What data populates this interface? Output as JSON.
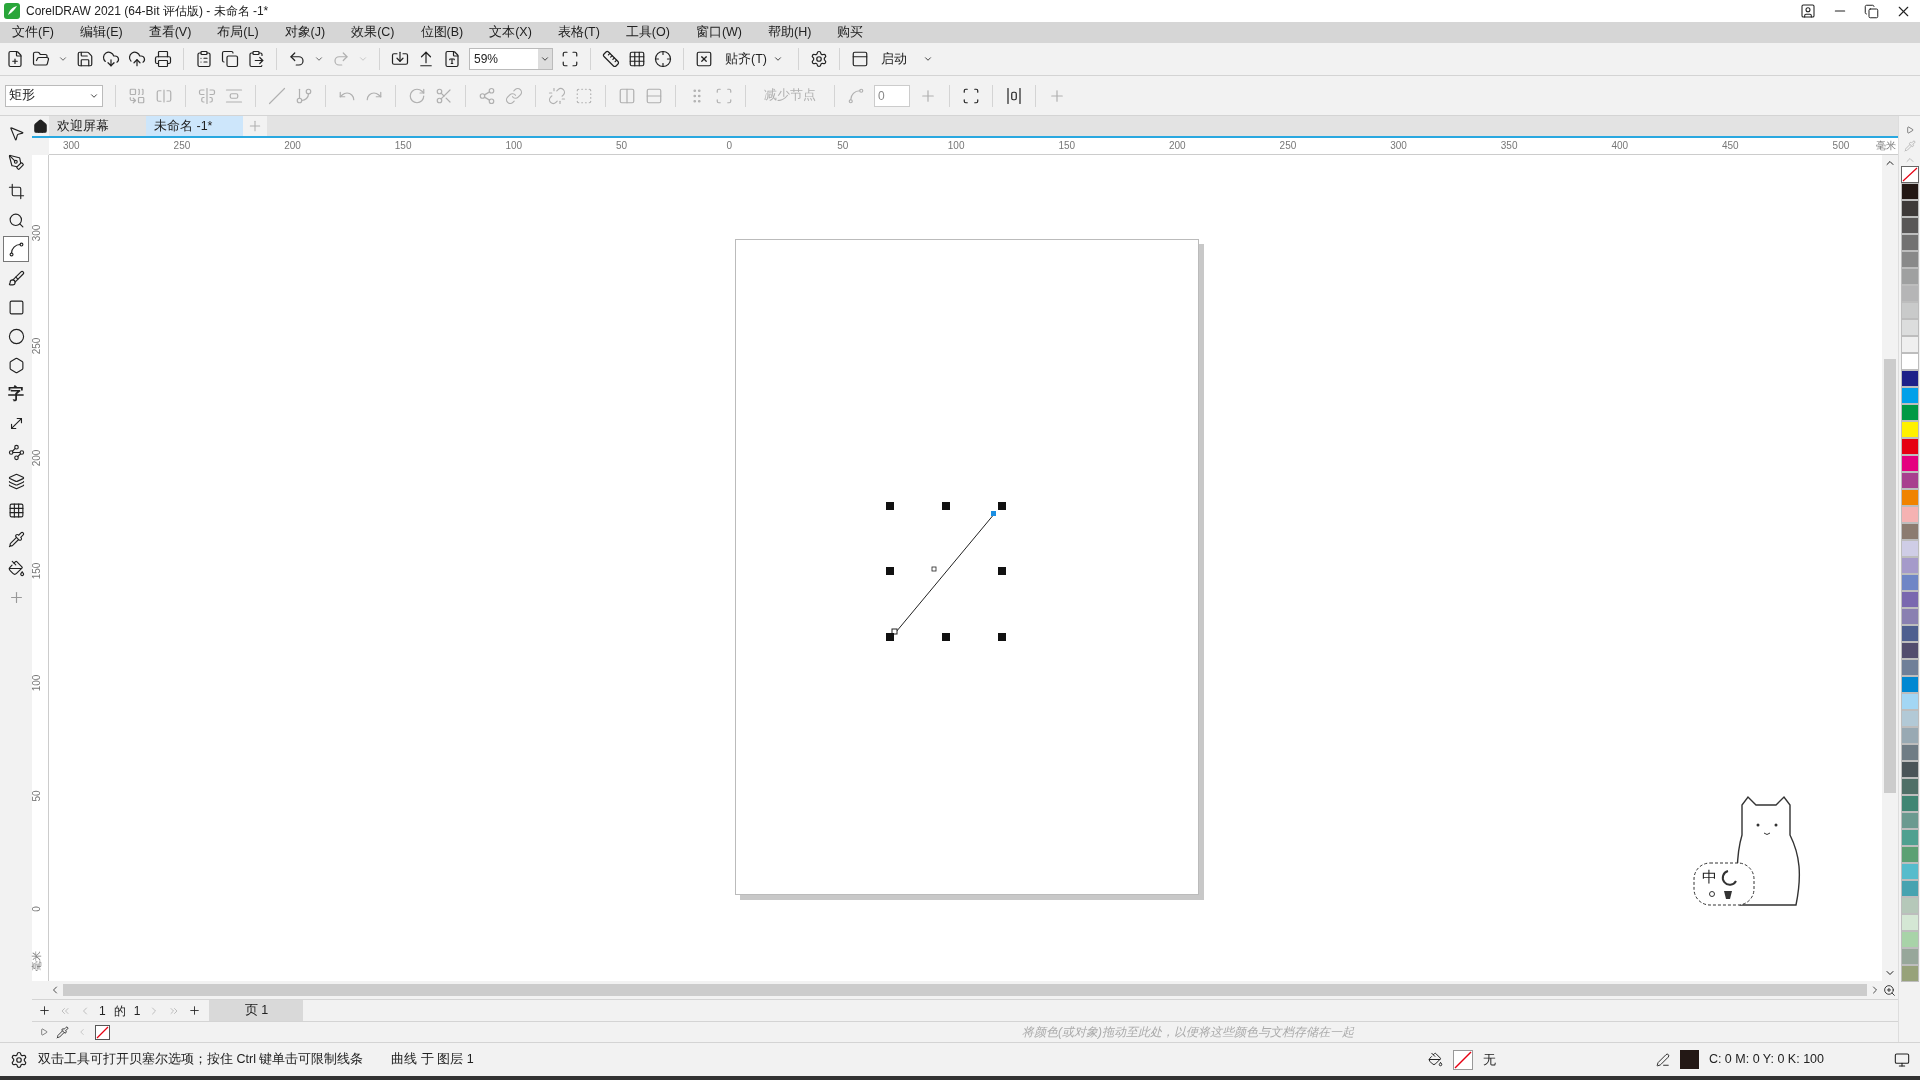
{
  "window": {
    "title": "CorelDRAW 2021 (64-Bit 评估版) - 未命名 -1*"
  },
  "menu": [
    "文件(F)",
    "编辑(E)",
    "查看(V)",
    "布局(L)",
    "对象(J)",
    "效果(C)",
    "位图(B)",
    "文本(X)",
    "表格(T)",
    "工具(O)",
    "窗口(W)",
    "帮助(H)",
    "购买"
  ],
  "toolbar": {
    "zoom": "59%",
    "snap": "贴齐(T)",
    "launch": "启动"
  },
  "property_bar": {
    "shape_type": "矩形",
    "reduce_nodes": {
      "label": "减少节点",
      "disabled": true
    },
    "smoothness": "0"
  },
  "tabs": [
    {
      "label": "欢迎屏幕",
      "selected": false
    },
    {
      "label": "未命名 -1*",
      "selected": true
    }
  ],
  "toolbox": [
    {
      "kind": "pointer",
      "selected": false
    },
    {
      "kind": "shape",
      "selected": false
    },
    {
      "kind": "crop",
      "selected": false
    },
    {
      "kind": "zoom",
      "selected": false
    },
    {
      "kind": "bezier",
      "selected": true
    },
    {
      "kind": "artistic",
      "selected": false
    },
    {
      "kind": "rectangle",
      "selected": false
    },
    {
      "kind": "ellipse",
      "selected": false
    },
    {
      "kind": "polygon",
      "selected": false
    },
    {
      "kind": "text",
      "glyph": "字",
      "selected": false
    },
    {
      "kind": "dimension",
      "selected": false
    },
    {
      "kind": "connector",
      "selected": false
    },
    {
      "kind": "shadow",
      "selected": false
    },
    {
      "kind": "transparency",
      "selected": false
    },
    {
      "kind": "eyedropper",
      "selected": false
    },
    {
      "kind": "fill",
      "selected": false
    },
    {
      "kind": "add",
      "selected": false
    }
  ],
  "rulers": {
    "horizontal": [
      "300",
      "250",
      "200",
      "150",
      "100",
      "50",
      "0",
      "50",
      "100",
      "150",
      "200",
      "250",
      "300",
      "350",
      "400",
      "450",
      "500"
    ],
    "unit": "毫米",
    "vertical": [
      "300",
      "250",
      "200",
      "150",
      "100",
      "50",
      "0"
    ],
    "vertical_unit": "毫米"
  },
  "ime": {
    "label": "中"
  },
  "page_nav": {
    "current": "1",
    "of": "的",
    "total": "1",
    "page_tab": "页 1"
  },
  "document_palette": {
    "hint": "将颜色(或对象)拖动至此处，以便将这些颜色与文档存储在一起"
  },
  "color_palette": [
    {
      "color": "#231815"
    },
    {
      "color": "#3e3a39"
    },
    {
      "color": "#595757"
    },
    {
      "color": "#727171"
    },
    {
      "color": "#898989"
    },
    {
      "color": "#9fa0a0"
    },
    {
      "color": "#b5b5b6"
    },
    {
      "color": "#c9caca"
    },
    {
      "color": "#dcdddd"
    },
    {
      "color": "#efefef"
    },
    {
      "color": "#ffffff"
    },
    {
      "color": "#1d2088"
    },
    {
      "color": "#00a0e9"
    },
    {
      "color": "#009944"
    },
    {
      "color": "#fff100"
    },
    {
      "color": "#e60012"
    },
    {
      "color": "#e4007f"
    },
    {
      "color": "#a83f8e"
    },
    {
      "color": "#f08300"
    },
    {
      "color": "#f5b2b2"
    },
    {
      "color": "#8c7b70"
    },
    {
      "color": "#cfcde6"
    },
    {
      "color": "#a59aca"
    },
    {
      "color": "#6f86c6"
    },
    {
      "color": "#7a68af"
    },
    {
      "color": "#8a80b1"
    },
    {
      "color": "#4e5f8f"
    },
    {
      "color": "#524d6e"
    },
    {
      "color": "#6f7f98"
    },
    {
      "color": "#0088d2"
    },
    {
      "color": "#a2d6f4"
    },
    {
      "color": "#b2c9d6"
    },
    {
      "color": "#98a9b3"
    },
    {
      "color": "#6f7c85"
    },
    {
      "color": "#4a5458"
    },
    {
      "color": "#4f6f67"
    },
    {
      "color": "#3f8673"
    },
    {
      "color": "#6b9a90"
    },
    {
      "color": "#4fa090"
    },
    {
      "color": "#5ca073"
    },
    {
      "color": "#56bccc"
    },
    {
      "color": "#47a3b0"
    },
    {
      "color": "#b5c8b9"
    },
    {
      "color": "#d4e7d4"
    },
    {
      "color": "#a8d3a8"
    },
    {
      "color": "#97a79a"
    },
    {
      "color": "#97a27a"
    }
  ],
  "status_bar": {
    "hint": "双击工具可打开贝塞尔选项；按住 Ctrl 键单击可限制线条",
    "selection": "曲线 于 图层 1",
    "fill": "无",
    "outline": "C: 0 M: 0 Y: 0 K: 100"
  }
}
